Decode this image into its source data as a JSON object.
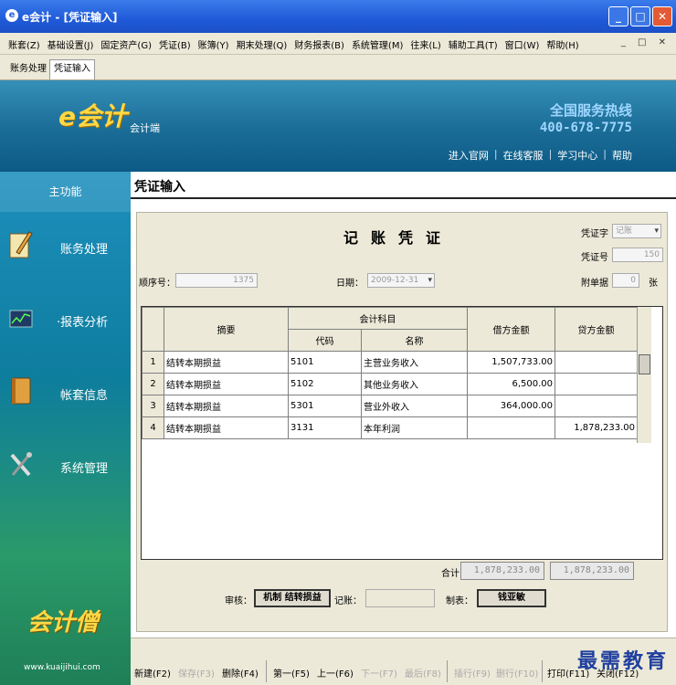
{
  "window": {
    "title": "e会计 - [凭证输入]"
  },
  "menu": [
    "账套(Z)",
    "基础设置(J)",
    "固定资产(G)",
    "凭证(B)",
    "账簿(Y)",
    "期末处理(Q)",
    "财务报表(B)",
    "系统管理(M)",
    "往来(L)",
    "辅助工具(T)",
    "窗口(W)",
    "帮助(H)"
  ],
  "tabs": [
    "账务处理",
    "凭证输入"
  ],
  "banner": {
    "logo": "e会计",
    "subtitle": "会计端",
    "hotline_label": "全国服务热线",
    "hotline_number": "400-678-7775",
    "links": [
      "进入官网",
      "在线客服",
      "学习中心",
      "帮助"
    ]
  },
  "sidebar": {
    "header": "主功能",
    "items": [
      "账务处理",
      "·报表分析",
      "帐套信息",
      "系统管理"
    ],
    "brand": "会计僧",
    "brand_url": "www.kuaijihui.com"
  },
  "page_title": "凭证输入",
  "voucher": {
    "title": "记账凭证",
    "word_label": "凭证字",
    "word_value": "记账",
    "number_label": "凭证号",
    "number_value": "150",
    "seq_label": "顺序号：",
    "seq_value": "1375",
    "date_label": "日期：",
    "date_value": "2009-12-31",
    "attach_label": "附单据",
    "attach_value": "0",
    "attach_unit": "张"
  },
  "grid": {
    "headers": {
      "summary": "摘要",
      "account": "会计科目",
      "code": "代码",
      "name": "名称",
      "debit": "借方金额",
      "credit": "贷方金额"
    },
    "rows": [
      {
        "idx": "1",
        "summary": "结转本期损益",
        "code": "5101",
        "name": "主营业务收入",
        "debit": "1,507,733.00",
        "credit": ""
      },
      {
        "idx": "2",
        "summary": "结转本期损益",
        "code": "5102",
        "name": "其他业务收入",
        "debit": "6,500.00",
        "credit": ""
      },
      {
        "idx": "3",
        "summary": "结转本期损益",
        "code": "5301",
        "name": "营业外收入",
        "debit": "364,000.00",
        "credit": ""
      },
      {
        "idx": "4",
        "summary": "结转本期损益",
        "code": "3131",
        "name": "本年利润",
        "debit": "",
        "credit": "1,878,233.00"
      }
    ]
  },
  "totals": {
    "label": "合计",
    "debit": "1,878,233.00",
    "credit": "1,878,233.00"
  },
  "signatures": {
    "audit_label": "审核：",
    "audit_value": "机制 结转损益",
    "post_label": "记账：",
    "post_value": "",
    "maker_label": "制表：",
    "maker_value": "钱亚敏"
  },
  "toolbar": {
    "new": "新建(F2)",
    "save": "保存(F3)",
    "delete": "删除(F4)",
    "first": "第一(F5)",
    "prev": "上一(F6)",
    "next": "下一(F7)",
    "last": "最后(F8)",
    "insert": "插行(F9)",
    "delrow": "删行(F10)",
    "print": "打印(F11)",
    "close": "关闭(F12)"
  },
  "watermark": "最需教育"
}
